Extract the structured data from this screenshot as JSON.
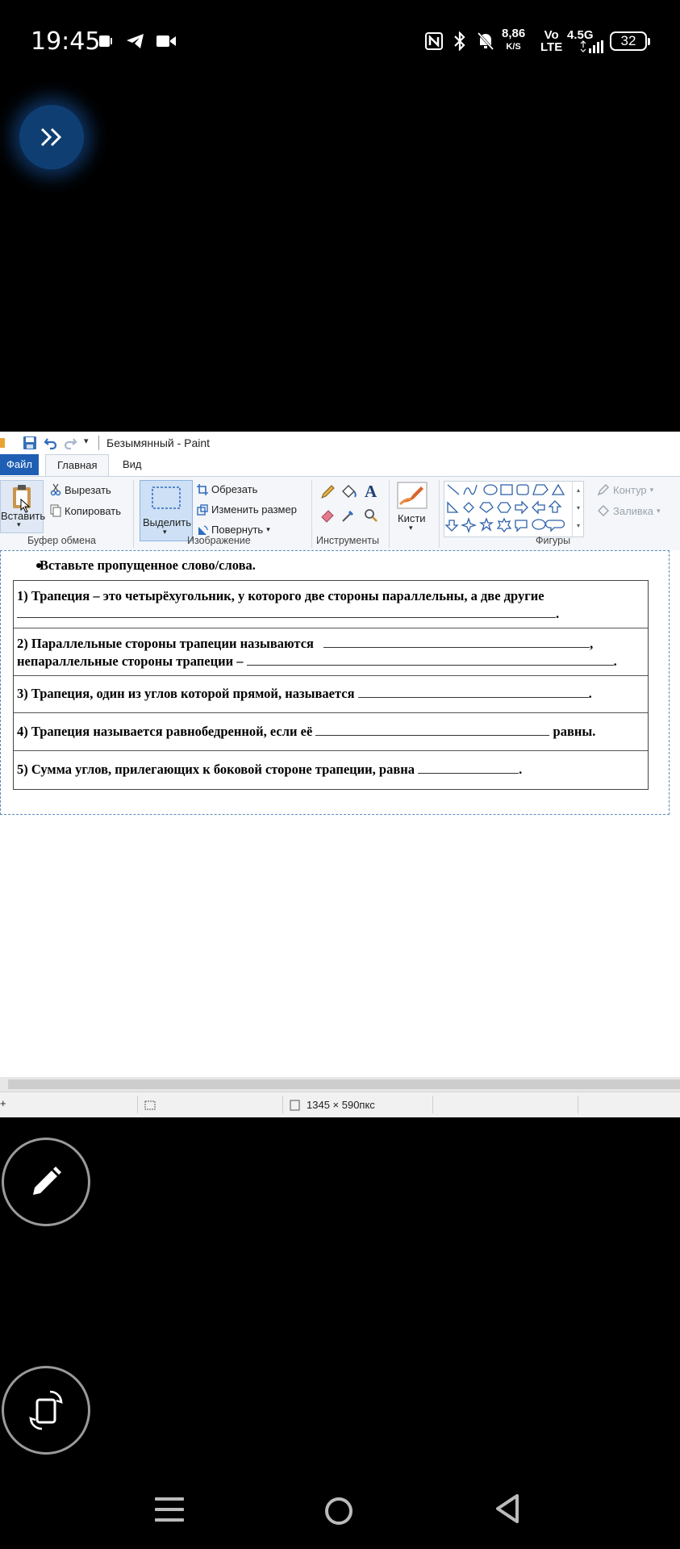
{
  "status_bar": {
    "time": "19:45",
    "net_speed_value": "8,86",
    "net_speed_unit": "K/S",
    "volte_top": "Vo",
    "volte_bottom": "LTE",
    "network": "4.5G",
    "battery": "32"
  },
  "paint": {
    "window_title": "Безымянный - Paint",
    "tabs": [
      "Файл",
      "Главная",
      "Вид"
    ],
    "clipboard": {
      "paste": "Вставить",
      "cut": "Вырезать",
      "copy": "Копировать",
      "group": "Буфер обмена"
    },
    "image": {
      "select": "Выделить",
      "crop": "Обрезать",
      "resize": "Изменить размер",
      "rotate": "Повернуть",
      "group": "Изображение"
    },
    "tools": {
      "group": "Инструменты"
    },
    "brushes": {
      "label": "Кисти"
    },
    "shapes": {
      "group": "Фигуры",
      "outline": "Контур",
      "fill": "Заливка"
    },
    "status": {
      "dimensions": "1345 × 590пкс"
    }
  },
  "document": {
    "instruction": "Вставьте пропущенное слово/слова.",
    "q1_line1": "1) Трапеция – это четырёхугольник, у которого две стороны параллельны, а две другие",
    "q2_line1": "2) Параллельные стороны трапеции называются",
    "q2_line2": "непараллельные стороны трапеции –",
    "q3": "3) Трапеция, один из углов которой прямой, называется",
    "q4_start": "4) Трапеция называется равнобедренной, если её",
    "q4_end": "равны.",
    "q5": "5) Сумма углов, прилегающих к боковой стороне трапеции, равна"
  },
  "colors": {
    "accent": "#1e5fb4",
    "fab": "#0f3e73"
  }
}
